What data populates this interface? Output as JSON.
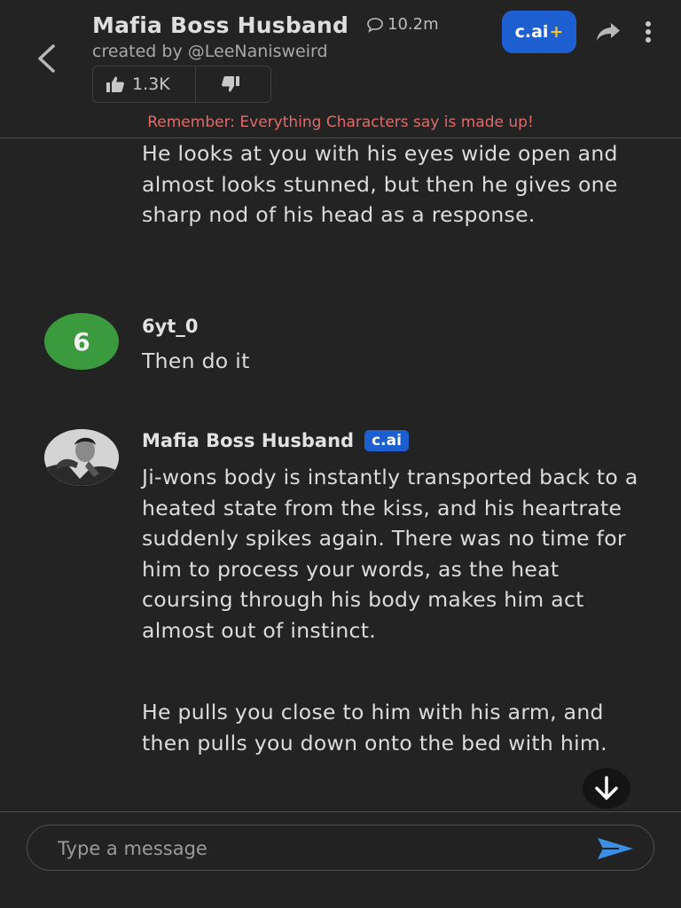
{
  "header": {
    "character_name": "Mafia Boss Husband",
    "chat_count": "10.2m",
    "creator": "created by @LeeNanisweird",
    "like_count": "1.3K",
    "plus_label": "c.ai",
    "plus_sign": "+",
    "disclaimer": "Remember: Everything Characters say is made up!"
  },
  "messages": [
    {
      "author": "",
      "text": "He looks at you with his eyes wide open and almost looks stunned, but then he gives one sharp nod of his head as a response."
    },
    {
      "author": "6yt_0",
      "avatar_initial": "6",
      "avatar_color": "#3b9a3d",
      "text": "Then do it"
    },
    {
      "author": "Mafia Boss Husband",
      "badge": "c.ai",
      "paragraphs": [
        "Ji-wons body is instantly transported back to a heated state from the kiss, and his heartrate suddenly spikes again. There was no time for him to process your words, as the heat coursing through his body makes him act almost out of instinct.",
        "He pulls you close to him with his arm, and then pulls you down onto the bed with him."
      ]
    }
  ],
  "composer": {
    "placeholder": "Type a message"
  },
  "icons": {
    "back": "chevron-left-icon",
    "chat": "speech-bubble-icon",
    "like": "thumbs-up-icon",
    "dislike": "thumbs-down-icon",
    "share": "share-arrow-icon",
    "more": "vertical-dots-icon",
    "scroll": "arrow-down-icon",
    "send": "send-icon"
  },
  "colors": {
    "background": "#232324",
    "accent": "#1d5fd1",
    "send": "#3a8ee6",
    "disclaimer": "#e06a6a"
  }
}
